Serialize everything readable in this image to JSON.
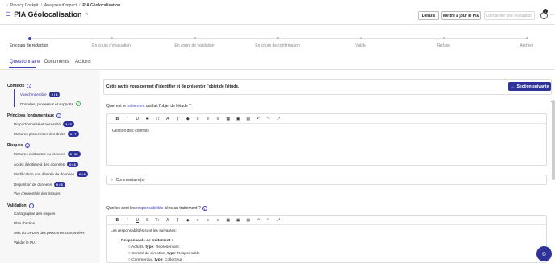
{
  "breadcrumb": {
    "items": [
      "Privacy Cockpit",
      "Analyses d'impact",
      "PIA Géolocalisation"
    ],
    "separator": "/"
  },
  "header": {
    "title": "PIA Géolocalisation",
    "buttons": {
      "details": "Détails",
      "update": "Mettre à jour le PIA",
      "validate": "Demander une évaluation"
    },
    "notification_count": "1"
  },
  "timeline": [
    {
      "label": "En cours de rédaction",
      "active": true
    },
    {
      "label": "En cours d'évaluation",
      "active": false
    },
    {
      "label": "En cours de validation",
      "active": false
    },
    {
      "label": "En cours de confirmation",
      "active": false
    },
    {
      "label": "Validé",
      "active": false
    },
    {
      "label": "Refusé",
      "active": false
    },
    {
      "label": "Archivé",
      "active": false
    }
  ],
  "tabs": [
    "Questionnaire",
    "Documents",
    "Actions"
  ],
  "sidebar": {
    "sections": [
      {
        "title": "Contexte",
        "items": [
          {
            "label": "Vue d'ensemble",
            "badge": "2 / 3"
          },
          {
            "label": "Données, processus et supports",
            "badge": ""
          }
        ]
      },
      {
        "title": "Principes fondamentaux",
        "items": [
          {
            "label": "Proportionnalité et nécessité",
            "badge": "2 / 3"
          },
          {
            "label": "Mesures protectrices des droits",
            "badge": "1 / 7"
          }
        ]
      },
      {
        "title": "Risques",
        "items": [
          {
            "label": "Mesures existantes ou prévues",
            "badge": "0 / 30"
          },
          {
            "label": "Accès illégitime à des données",
            "badge": "0 / 6"
          },
          {
            "label": "Modification non désirée de données",
            "badge": "0 / 6"
          },
          {
            "label": "Disparition de données",
            "badge": "0 / 6"
          },
          {
            "label": "Vue d'ensemble des risques",
            "badge": ""
          }
        ]
      },
      {
        "title": "Validation",
        "items": [
          {
            "label": "Cartographie des risques",
            "badge": ""
          },
          {
            "label": "Plan d'action",
            "badge": ""
          },
          {
            "label": "Avis du DPD et des personnes concernées",
            "badge": ""
          },
          {
            "label": "Valider le PIA",
            "badge": ""
          }
        ]
      }
    ]
  },
  "main": {
    "intro": "Cette partie vous permet d'identifier et de présenter l'objet de l'étude.",
    "next_button": "Section suivante",
    "q1": {
      "prefix": "Quel est le ",
      "keyword": "traitement",
      "suffix": " qui fait l'objet de l'étude ?",
      "answer": "Gestion des contrats"
    },
    "comment_label": "Commentaire(s)",
    "q2": {
      "prefix": "Quelles sont les ",
      "keyword": "responsabilités",
      "suffix": " liées au traitement ?",
      "intro": "Les responsabilités sont les suivantes:",
      "bullet": "Responsable de traitement :",
      "lines": [
        {
          "a": "Achats, ",
          "b": "type",
          "c": ": Représentant"
        },
        {
          "a": "Comité de direction, ",
          "b": "type",
          "c": ": Responsable"
        },
        {
          "a": "Commercial, ",
          "b": "type",
          "c": ": Collecteur"
        }
      ]
    },
    "toolbar": [
      "B",
      "I",
      "U",
      "S",
      "T↕",
      "A",
      "¶",
      "◆",
      "≡",
      "≡",
      "≡",
      "▦",
      "▣",
      "▤",
      "↶",
      "↷",
      "⤢"
    ]
  }
}
